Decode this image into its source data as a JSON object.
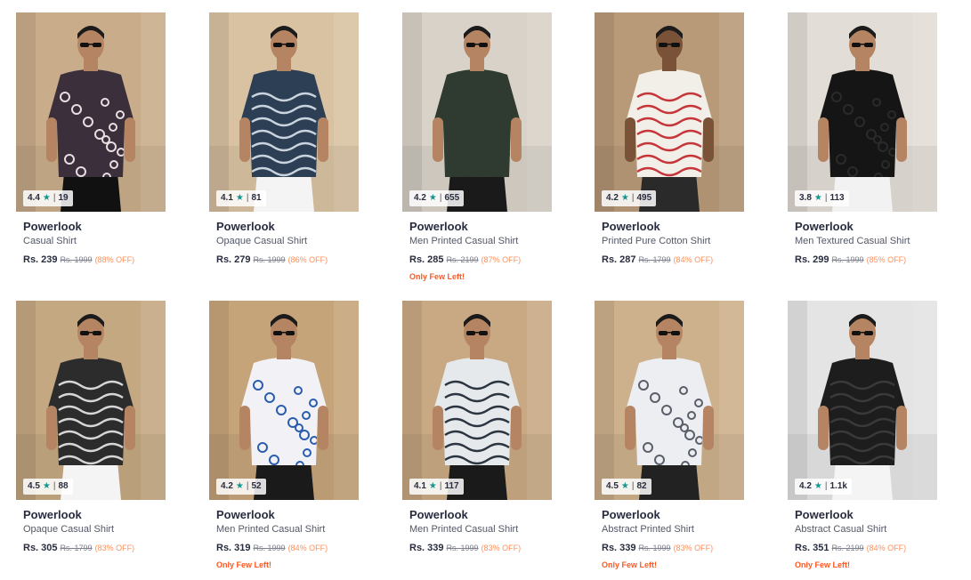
{
  "products": [
    {
      "brand": "Powerlook",
      "name": "Casual Shirt",
      "rating": "4.4",
      "reviews": "19",
      "price": "Rs. 239",
      "mrp": "Rs. 1999",
      "discount": "(88% OFF)",
      "few": "",
      "bg": "#c9ad8a",
      "shirt": "#3a2f3a",
      "pattern": "#e8dde0",
      "pants": "#111111",
      "skin": "#b58563"
    },
    {
      "brand": "Powerlook",
      "name": "Opaque Casual Shirt",
      "rating": "4.1",
      "reviews": "81",
      "price": "Rs. 279",
      "mrp": "Rs. 1999",
      "discount": "(86% OFF)",
      "few": "",
      "bg": "#d9c2a2",
      "shirt": "#2d3f55",
      "pattern": "#c9d4de",
      "pants": "#f4f4f4",
      "skin": "#b58563"
    },
    {
      "brand": "Powerlook",
      "name": "Men Printed Casual Shirt",
      "rating": "4.2",
      "reviews": "655",
      "price": "Rs. 285",
      "mrp": "Rs. 2199",
      "discount": "(87% OFF)",
      "few": "Only Few Left!",
      "bg": "#d8d2c8",
      "shirt": "#2f3a30",
      "pattern": "#2f3a30",
      "pants": "#1a1a1a",
      "skin": "#b58563"
    },
    {
      "brand": "Powerlook",
      "name": "Printed Pure Cotton Shirt",
      "rating": "4.2",
      "reviews": "495",
      "price": "Rs. 287",
      "mrp": "Rs. 1799",
      "discount": "(84% OFF)",
      "few": "",
      "bg": "#b89a78",
      "shirt": "#f1efe8",
      "pattern": "#c6353a",
      "pants": "#2a2a2a",
      "skin": "#7a5238"
    },
    {
      "brand": "Powerlook",
      "name": "Men Textured Casual Shirt",
      "rating": "3.8",
      "reviews": "113",
      "price": "Rs. 299",
      "mrp": "Rs. 1999",
      "discount": "(85% OFF)",
      "few": "",
      "bg": "#e2ddd6",
      "shirt": "#151515",
      "pattern": "#2a2a2a",
      "pants": "#f2f2f2",
      "skin": "#b58563"
    },
    {
      "brand": "Powerlook",
      "name": "Opaque Casual Shirt",
      "rating": "4.5",
      "reviews": "88",
      "price": "Rs. 305",
      "mrp": "Rs. 1799",
      "discount": "(83% OFF)",
      "few": "",
      "bg": "#c4a882",
      "shirt": "#2c2c2c",
      "pattern": "#d6d6d6",
      "pants": "#f4f4f4",
      "skin": "#b58563"
    },
    {
      "brand": "Powerlook",
      "name": "Men Printed Casual Shirt",
      "rating": "4.2",
      "reviews": "52",
      "price": "Rs. 319",
      "mrp": "Rs. 1999",
      "discount": "(84% OFF)",
      "few": "Only Few Left!",
      "bg": "#c6a47a",
      "shirt": "#f2f2f6",
      "pattern": "#2a5db0",
      "pants": "#1a1a1a",
      "skin": "#b58563"
    },
    {
      "brand": "Powerlook",
      "name": "Men Printed Casual Shirt",
      "rating": "4.1",
      "reviews": "117",
      "price": "Rs. 339",
      "mrp": "Rs. 1999",
      "discount": "(83% OFF)",
      "few": "",
      "bg": "#c9a984",
      "shirt": "#e6e9ec",
      "pattern": "#2b3540",
      "pants": "#1a1a1a",
      "skin": "#b58563"
    },
    {
      "brand": "Powerlook",
      "name": "Abstract Printed Shirt",
      "rating": "4.5",
      "reviews": "82",
      "price": "Rs. 339",
      "mrp": "Rs. 1999",
      "discount": "(83% OFF)",
      "few": "Only Few Left!",
      "bg": "#cdb08c",
      "shirt": "#eceef2",
      "pattern": "#5a5f6a",
      "pants": "#222222",
      "skin": "#b58563"
    },
    {
      "brand": "Powerlook",
      "name": "Abstract Casual Shirt",
      "rating": "4.2",
      "reviews": "1.1k",
      "price": "Rs. 351",
      "mrp": "Rs. 2199",
      "discount": "(84% OFF)",
      "few": "Only Few Left!",
      "bg": "#e4e4e4",
      "shirt": "#1d1d1d",
      "pattern": "#3a3a3a",
      "pants": "#f4f4f4",
      "skin": "#b58563"
    }
  ]
}
